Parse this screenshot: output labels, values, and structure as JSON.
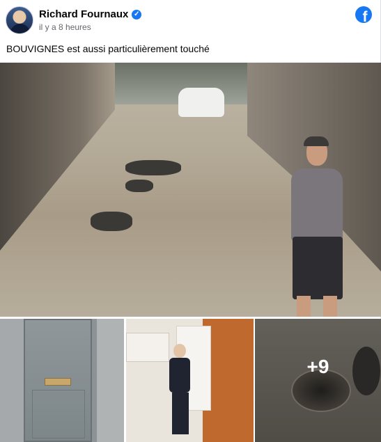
{
  "post": {
    "author": "Richard Fournaux",
    "verified": true,
    "timestamp": "il y a 8 heures",
    "caption": "BOUVIGNES est aussi particulièrement touché",
    "more_photos_label": "+9"
  },
  "icons": {
    "verified": "verified-badge-icon",
    "brand": "facebook-logo"
  },
  "colors": {
    "brand_blue": "#1877f2",
    "text_primary": "#050505",
    "text_secondary": "#65676b"
  },
  "photos": [
    {
      "name": "flooded-street-photo"
    },
    {
      "name": "door-photo"
    },
    {
      "name": "kitchen-photo"
    },
    {
      "name": "drain-photo"
    }
  ]
}
